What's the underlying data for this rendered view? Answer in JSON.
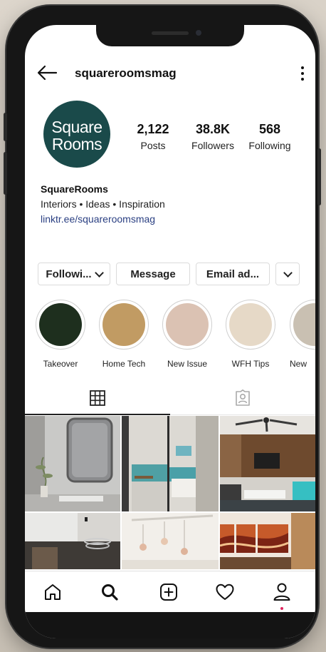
{
  "profile": {
    "username": "squareroomsmag",
    "avatar_line1": "Square",
    "avatar_line2": "Rooms",
    "avatar_color": "#1a4a4a"
  },
  "stats": [
    {
      "value": "2,122",
      "label": "Posts"
    },
    {
      "value": "38.8K",
      "label": "Followers"
    },
    {
      "value": "568",
      "label": "Following"
    }
  ],
  "bio": {
    "name": "SquareRooms",
    "tagline": "Interiors • Ideas • Inspiration",
    "link": "linktr.ee/squareroomsmag"
  },
  "buttons": {
    "following": "Followi...",
    "message": "Message",
    "email": "Email ad..."
  },
  "highlights": [
    {
      "label": "Takeover",
      "color": "#1e2f1e"
    },
    {
      "label": "Home Tech",
      "color": "#c19b63"
    },
    {
      "label": "New Issue",
      "color": "#dbc2b3"
    },
    {
      "label": "WFH Tips",
      "color": "#e6d9c7"
    },
    {
      "label": "New",
      "color": "#c9c0b2"
    }
  ],
  "tabs": [
    {
      "icon": "grid-icon",
      "active": true
    },
    {
      "icon": "tagged-icon",
      "active": false
    }
  ],
  "nav": [
    {
      "icon": "home-icon"
    },
    {
      "icon": "search-icon"
    },
    {
      "icon": "new-post-icon"
    },
    {
      "icon": "heart-icon"
    },
    {
      "icon": "profile-icon"
    }
  ],
  "colors": {
    "link": "#2a3f82",
    "notification": "#e0245e"
  }
}
